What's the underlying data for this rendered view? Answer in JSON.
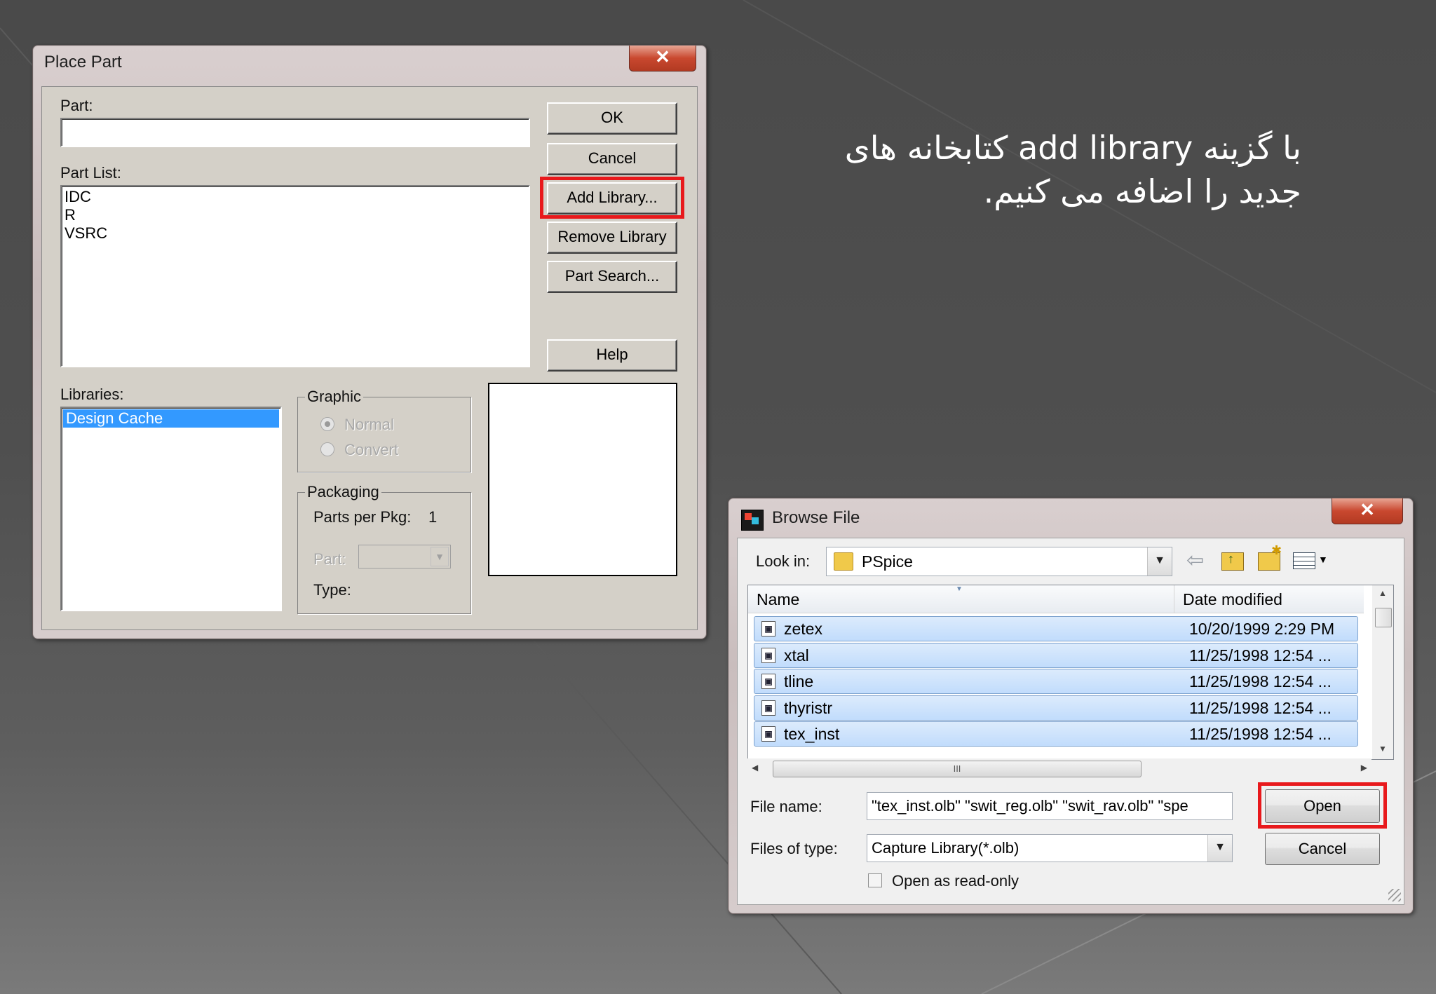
{
  "caption": {
    "line1": "با گزینه  add library کتابخانه های",
    "line2": "جدید را اضافه می کنیم."
  },
  "place_part": {
    "title": "Place Part",
    "close_glyph": "✕",
    "part_label": "Part:",
    "part_value": "",
    "part_list_label": "Part List:",
    "part_list": [
      "IDC",
      "R",
      "VSRC"
    ],
    "libraries_label": "Libraries:",
    "libraries": [
      "Design Cache"
    ],
    "graphic": {
      "title": "Graphic",
      "normal": "Normal",
      "convert": "Convert"
    },
    "packaging": {
      "title": "Packaging",
      "parts_per_pkg_label": "Parts per Pkg:",
      "parts_per_pkg_value": "1",
      "part_label": "Part:",
      "type_label": "Type:"
    },
    "buttons": {
      "ok": "OK",
      "cancel": "Cancel",
      "add_library": "Add Library...",
      "remove_library": "Remove Library",
      "part_search": "Part Search...",
      "help": "Help"
    }
  },
  "browse_file": {
    "title": "Browse File",
    "close_glyph": "✕",
    "look_in_label": "Look in:",
    "look_in_value": "PSpice",
    "columns": {
      "name": "Name",
      "date": "Date modified"
    },
    "files": [
      {
        "name": "zetex",
        "date": "10/20/1999 2:29 PM"
      },
      {
        "name": "xtal",
        "date": "11/25/1998 12:54 ..."
      },
      {
        "name": "tline",
        "date": "11/25/1998 12:54 ..."
      },
      {
        "name": "thyristr",
        "date": "11/25/1998 12:54 ..."
      },
      {
        "name": "tex_inst",
        "date": "11/25/1998 12:54 ..."
      }
    ],
    "hscroll_grip": "III",
    "file_name_label": "File name:",
    "file_name_value": "\"tex_inst.olb\" \"swit_reg.olb\" \"swit_rav.olb\" \"spe",
    "files_of_type_label": "Files of type:",
    "files_of_type_value": "Capture Library(*.olb)",
    "open_readonly_label": "Open as read-only",
    "open_readonly_checked": false,
    "buttons": {
      "open": "Open",
      "cancel": "Cancel"
    }
  },
  "colors": {
    "highlight_red": "#e8191c",
    "selection_blue": "#3399ff",
    "dialog_face": "#d4d0c8"
  }
}
